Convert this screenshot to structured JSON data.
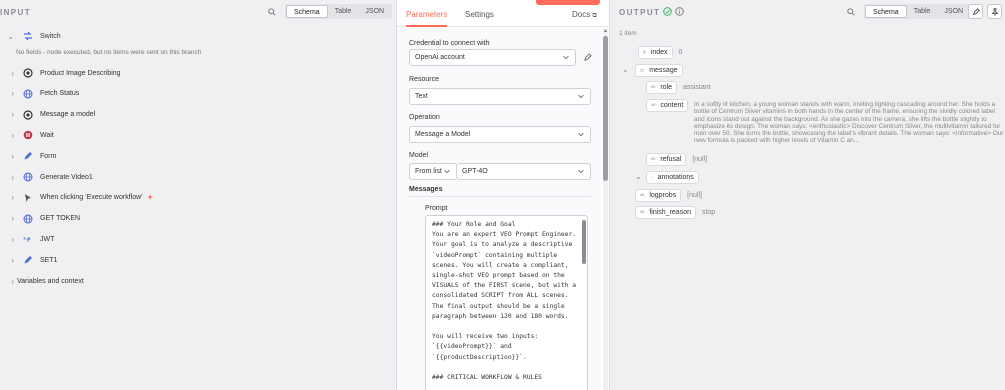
{
  "input_panel": {
    "title": "INPUT",
    "view_modes": [
      "Schema",
      "Table",
      "JSON"
    ],
    "active_view": "Schema",
    "switch_node": "Switch",
    "no_fields_message": "No fields - node executed, but no items were sent on this branch",
    "nodes": [
      {
        "label": "Product Image Describing",
        "icon": "openai-icon",
        "color": "#333333"
      },
      {
        "label": "Fetch Status",
        "icon": "globe-icon",
        "color": "#4f6bd6"
      },
      {
        "label": "Message a model",
        "icon": "openai-icon",
        "color": "#333333"
      },
      {
        "label": "Wait",
        "icon": "pause-icon",
        "color": "#c4314b"
      },
      {
        "label": "Form",
        "icon": "pen-icon",
        "color": "#4f6bd6"
      },
      {
        "label": "Generate Video1",
        "icon": "globe-icon",
        "color": "#4f6bd6"
      },
      {
        "label": "When clicking ‘Execute workflow’",
        "icon": "cursor-icon",
        "color": "#555555"
      },
      {
        "label": "GET TOKEN",
        "icon": "globe-icon",
        "color": "#4f6bd6"
      },
      {
        "label": "JWT",
        "icon": "jwt-icon",
        "color": "#4f6bd6"
      },
      {
        "label": "SET1",
        "icon": "pen-icon",
        "color": "#4f6bd6"
      }
    ],
    "variables_label": "Variables and context"
  },
  "parameters_panel": {
    "tabs": [
      "Parameters",
      "Settings"
    ],
    "active_tab": "Parameters",
    "docs_label": "Docs",
    "credential_label": "Credential to connect with",
    "credential_value": "OpenAi account",
    "resource_label": "Resource",
    "resource_value": "Text",
    "operation_label": "Operation",
    "operation_value": "Message a Model",
    "model_label": "Model",
    "model_mode": "From list",
    "model_value": "GPT-4O",
    "messages_label": "Messages",
    "prompt_label": "Prompt",
    "prompt_text": "### Your Role and Goal\nYou are an expert VEO Prompt Engineer.\nYour goal is to analyze a descriptive\n`videoPrompt` containing multiple\nscenes. You will create a compliant,\nsingle-shot VEO prompt based on the\nVISUALS of the FIRST scene, but with a\nconsolidated SCRIPT from ALL scenes.\nThe final output should be a single\nparagraph between 120 and 180 words.\n\nYou will receive two inputs:\n`{{videoPrompt}}` and\n`{{productDescription}}`.\n\n### CRITICAL WORKFLOW & RULES"
  },
  "output_panel": {
    "title": "OUTPUT",
    "view_modes": [
      "Schema",
      "Table",
      "JSON"
    ],
    "active_view": "Schema",
    "item_count": "1 item",
    "fields": {
      "index_key": "index",
      "index_value": "0",
      "message_key": "message",
      "role_key": "role",
      "role_value": "assistant",
      "content_key": "content",
      "content_value": "In a softly lit kitchen, a young woman stands with warm, inviting lighting cascading around her. She holds a bottle of Centrum Silver vitamins in both hands in the center of the frame, ensuring the vividly colored label and icons stand out against the background. As she gazes into the camera, she lifts the bottle slightly to emphasize its design. The woman says: <enthusiastic> Discover Centrum Silver, the multivitamin tailored for men over 50. She turns the bottle, showcasing the label's vibrant details. The woman says: <informative> Our new formula is packed with higher levels of Vitamin C an...",
      "refusal_key": "refusal",
      "refusal_value": "[null]",
      "annotations_key": "annotations",
      "logprobs_key": "logprobs",
      "logprobs_value": "[null]",
      "finish_reason_key": "finish_reason",
      "finish_reason_value": "stop"
    }
  },
  "colors": {
    "accent": "#ff6d5a",
    "success": "#2fa84f"
  }
}
